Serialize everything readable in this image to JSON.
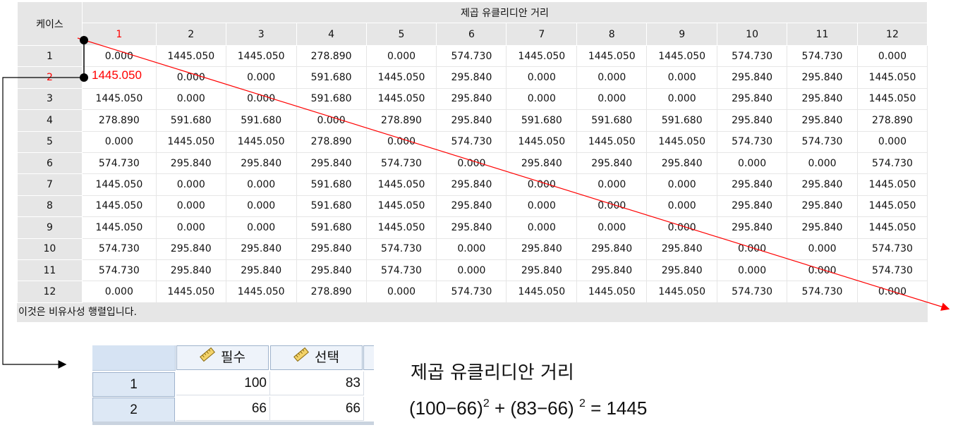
{
  "matrix": {
    "case_header": "케이스",
    "span_header": "제곱 유클리디안 거리",
    "columns": [
      "1",
      "2",
      "3",
      "4",
      "5",
      "6",
      "7",
      "8",
      "9",
      "10",
      "11",
      "12"
    ],
    "rows": [
      {
        "label": "1",
        "values": [
          "0.000",
          "1445.050",
          "1445.050",
          "278.890",
          "0.000",
          "574.730",
          "1445.050",
          "1445.050",
          "1445.050",
          "574.730",
          "574.730",
          "0.000"
        ]
      },
      {
        "label": "2",
        "values": [
          "",
          "0.000",
          "0.000",
          "591.680",
          "1445.050",
          "295.840",
          "0.000",
          "0.000",
          "0.000",
          "295.840",
          "295.840",
          "1445.050"
        ]
      },
      {
        "label": "3",
        "values": [
          "1445.050",
          "0.000",
          "0.000",
          "591.680",
          "1445.050",
          "295.840",
          "0.000",
          "0.000",
          "0.000",
          "295.840",
          "295.840",
          "1445.050"
        ]
      },
      {
        "label": "4",
        "values": [
          "278.890",
          "591.680",
          "591.680",
          "0.000",
          "278.890",
          "295.840",
          "591.680",
          "591.680",
          "591.680",
          "295.840",
          "295.840",
          "278.890"
        ]
      },
      {
        "label": "5",
        "values": [
          "0.000",
          "1445.050",
          "1445.050",
          "278.890",
          "0.000",
          "574.730",
          "1445.050",
          "1445.050",
          "1445.050",
          "574.730",
          "574.730",
          "0.000"
        ]
      },
      {
        "label": "6",
        "values": [
          "574.730",
          "295.840",
          "295.840",
          "295.840",
          "574.730",
          "0.000",
          "295.840",
          "295.840",
          "295.840",
          "0.000",
          "0.000",
          "574.730"
        ]
      },
      {
        "label": "7",
        "values": [
          "1445.050",
          "0.000",
          "0.000",
          "591.680",
          "1445.050",
          "295.840",
          "0.000",
          "0.000",
          "0.000",
          "295.840",
          "295.840",
          "1445.050"
        ]
      },
      {
        "label": "8",
        "values": [
          "1445.050",
          "0.000",
          "0.000",
          "591.680",
          "1445.050",
          "295.840",
          "0.000",
          "0.000",
          "0.000",
          "295.840",
          "295.840",
          "1445.050"
        ]
      },
      {
        "label": "9",
        "values": [
          "1445.050",
          "0.000",
          "0.000",
          "591.680",
          "1445.050",
          "295.840",
          "0.000",
          "0.000",
          "0.000",
          "295.840",
          "295.840",
          "1445.050"
        ]
      },
      {
        "label": "10",
        "values": [
          "574.730",
          "295.840",
          "295.840",
          "295.840",
          "574.730",
          "0.000",
          "295.840",
          "295.840",
          "295.840",
          "0.000",
          "0.000",
          "574.730"
        ]
      },
      {
        "label": "11",
        "values": [
          "574.730",
          "295.840",
          "295.840",
          "295.840",
          "574.730",
          "0.000",
          "295.840",
          "295.840",
          "295.840",
          "0.000",
          "0.000",
          "574.730"
        ]
      },
      {
        "label": "12",
        "values": [
          "0.000",
          "1445.050",
          "1445.050",
          "278.890",
          "0.000",
          "574.730",
          "1445.050",
          "1445.050",
          "1445.050",
          "574.730",
          "574.730",
          "0.000"
        ]
      }
    ],
    "footnote": "이것은 비유사성 행렬입니다.",
    "highlight_value": "1445.050",
    "highlight_color": "#ff0000"
  },
  "data_view": {
    "variables": [
      {
        "name": "필수",
        "icon": "ruler-icon"
      },
      {
        "name": "선택",
        "icon": "ruler-icon"
      }
    ],
    "rows": [
      {
        "case": "1",
        "values": [
          "100",
          "83"
        ]
      },
      {
        "case": "2",
        "values": [
          "66",
          "66"
        ]
      }
    ]
  },
  "formula": {
    "title": "제곱 유클리디안 거리",
    "term1": "(100−66)",
    "exp1": "2",
    "plus": " + ",
    "term2": "(83−66) ",
    "exp2": "2",
    "result": " = 1445"
  }
}
